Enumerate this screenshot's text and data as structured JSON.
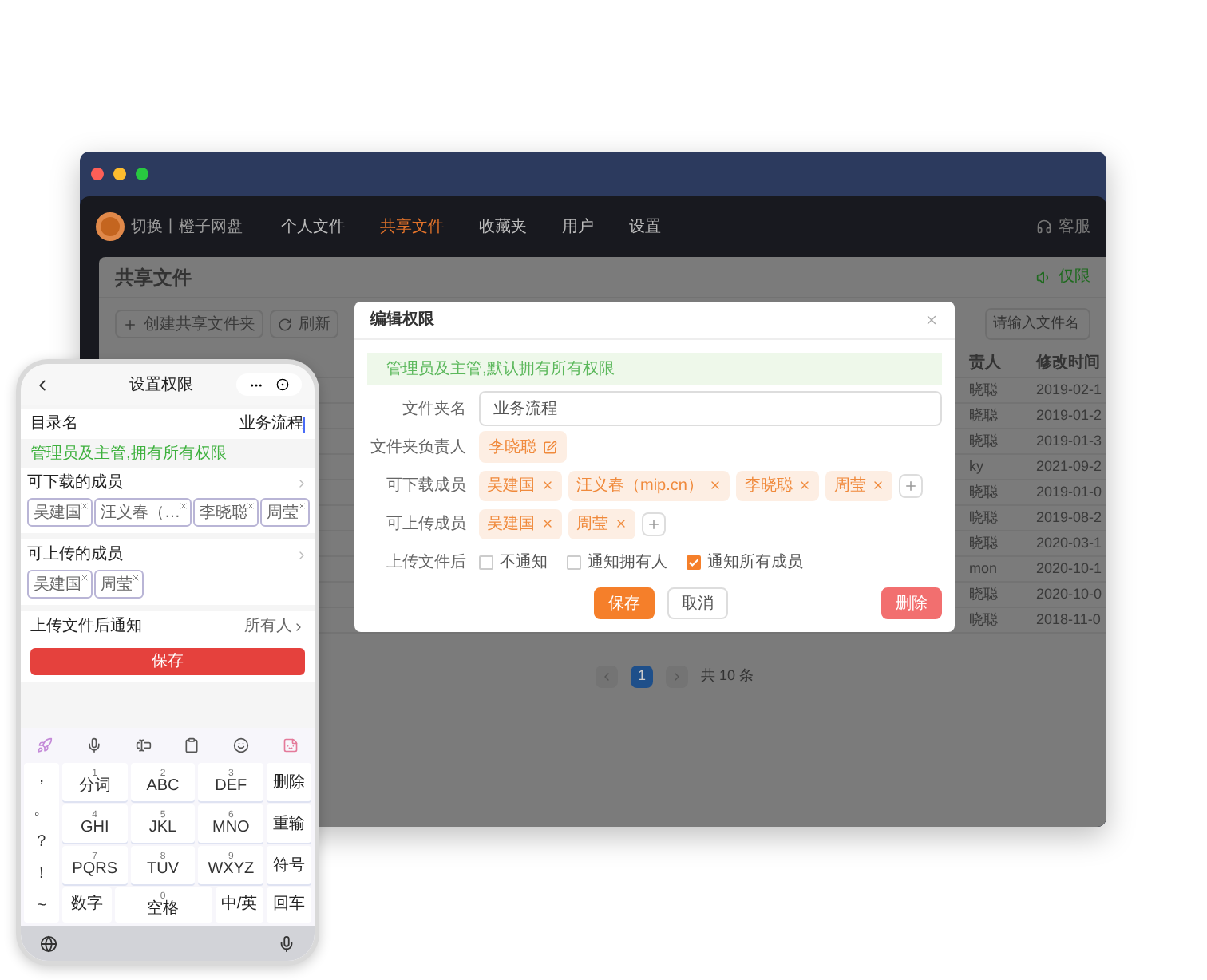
{
  "desktop": {
    "app_header": {
      "brand": "切换丨橙子网盘",
      "nav": [
        {
          "label": "个人文件",
          "selected": false
        },
        {
          "label": "共享文件",
          "selected": true
        },
        {
          "label": "收藏夹",
          "selected": false
        },
        {
          "label": "用户",
          "selected": false
        },
        {
          "label": "设置",
          "selected": false
        }
      ],
      "support": "客服"
    },
    "page": {
      "title": "共享文件",
      "notice": "仅限",
      "toolbar": [
        {
          "kind": "create",
          "label": "创建共享文件夹"
        },
        {
          "kind": "refresh",
          "label": "刷新"
        }
      ],
      "search": {
        "placeholder": "请输入文件名"
      },
      "table": {
        "columns": [
          "责人",
          "修改时间"
        ],
        "rows": [
          [
            "晓聪",
            "2019-02-1"
          ],
          [
            "晓聪",
            "2019-01-2"
          ],
          [
            "晓聪",
            "2019-01-3"
          ],
          [
            "ky",
            "2021-09-2"
          ],
          [
            "晓聪",
            "2019-01-0"
          ],
          [
            "晓聪",
            "2019-08-2"
          ],
          [
            "晓聪",
            "2020-03-1"
          ],
          [
            "mon",
            "2020-10-1"
          ],
          [
            "晓聪",
            "2020-10-0"
          ],
          [
            "晓聪",
            "2018-11-0"
          ]
        ]
      },
      "pagination": {
        "pages": [
          {
            "label": "1",
            "selected": true
          }
        ],
        "total": "共 10 条"
      }
    },
    "modal": {
      "title": "编辑权限",
      "alert": "管理员及主管,默认拥有所有权限",
      "fields": [
        {
          "kind": "input",
          "label": "文件夹名",
          "value": "业务流程"
        },
        {
          "kind": "owner",
          "label": "文件夹负责人",
          "tags": [
            "李晓聪"
          ]
        },
        {
          "kind": "tags",
          "label": "可下载成员",
          "tags": [
            "吴建国",
            "汪义春（mip.cn）",
            "李晓聪",
            "周莹"
          ]
        },
        {
          "kind": "tags",
          "label": "可上传成员",
          "tags": [
            "吴建国",
            "周莹"
          ]
        },
        {
          "kind": "checks",
          "label": "上传文件后",
          "options": [
            {
              "label": "不通知",
              "checked": false
            },
            {
              "label": "通知拥有人",
              "checked": false
            },
            {
              "label": "通知所有成员",
              "checked": true
            }
          ]
        }
      ],
      "buttons": [
        {
          "kind": "primary",
          "label": "保存"
        },
        {
          "kind": "default",
          "label": "取消"
        },
        {
          "kind": "danger",
          "label": "删除"
        }
      ]
    }
  },
  "phone": {
    "title": "设置权限",
    "dir": {
      "label": "目录名",
      "value": "业务流程"
    },
    "notice": "管理员及主管,拥有所有权限",
    "sections": [
      {
        "title": "可下载的成员",
        "tags": [
          "吴建国",
          "汪义春（…",
          "李晓聪",
          "周莹"
        ]
      },
      {
        "title": "可上传的成员",
        "tags": [
          "吴建国",
          "周莹"
        ]
      }
    ],
    "notify": {
      "label": "上传文件后通知",
      "value": "所有人"
    },
    "save": "保存",
    "keyboard": {
      "symbols": [
        "，",
        "。",
        "？",
        "！",
        "~"
      ],
      "keys": [
        {
          "num": "1",
          "label": "分词"
        },
        {
          "num": "2",
          "label": "ABC"
        },
        {
          "num": "3",
          "label": "DEF"
        },
        {
          "num": "4",
          "label": "GHI"
        },
        {
          "num": "5",
          "label": "JKL"
        },
        {
          "num": "6",
          "label": "MNO"
        },
        {
          "num": "7",
          "label": "PQRS"
        },
        {
          "num": "8",
          "label": "TUV"
        },
        {
          "num": "9",
          "label": "WXYZ"
        }
      ],
      "side": [
        "删除",
        "重输",
        "符号"
      ],
      "bottom": [
        {
          "kind": "key",
          "label": "数字"
        },
        {
          "kind": "space",
          "num": "0",
          "label": "空格"
        },
        {
          "kind": "key",
          "label": "中/英"
        },
        {
          "kind": "key",
          "label": "回车"
        }
      ]
    }
  }
}
